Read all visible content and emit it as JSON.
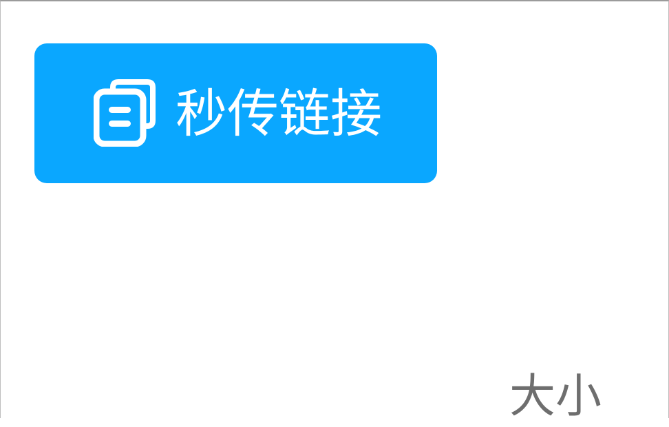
{
  "rapid_link_button": {
    "label": "秒传链接",
    "icon": "copy-icon",
    "background": "#0aa7ff",
    "text_color": "#ffffff"
  },
  "file_list": {
    "size_column_header": "大小",
    "header_color": "#6e6e6e"
  }
}
